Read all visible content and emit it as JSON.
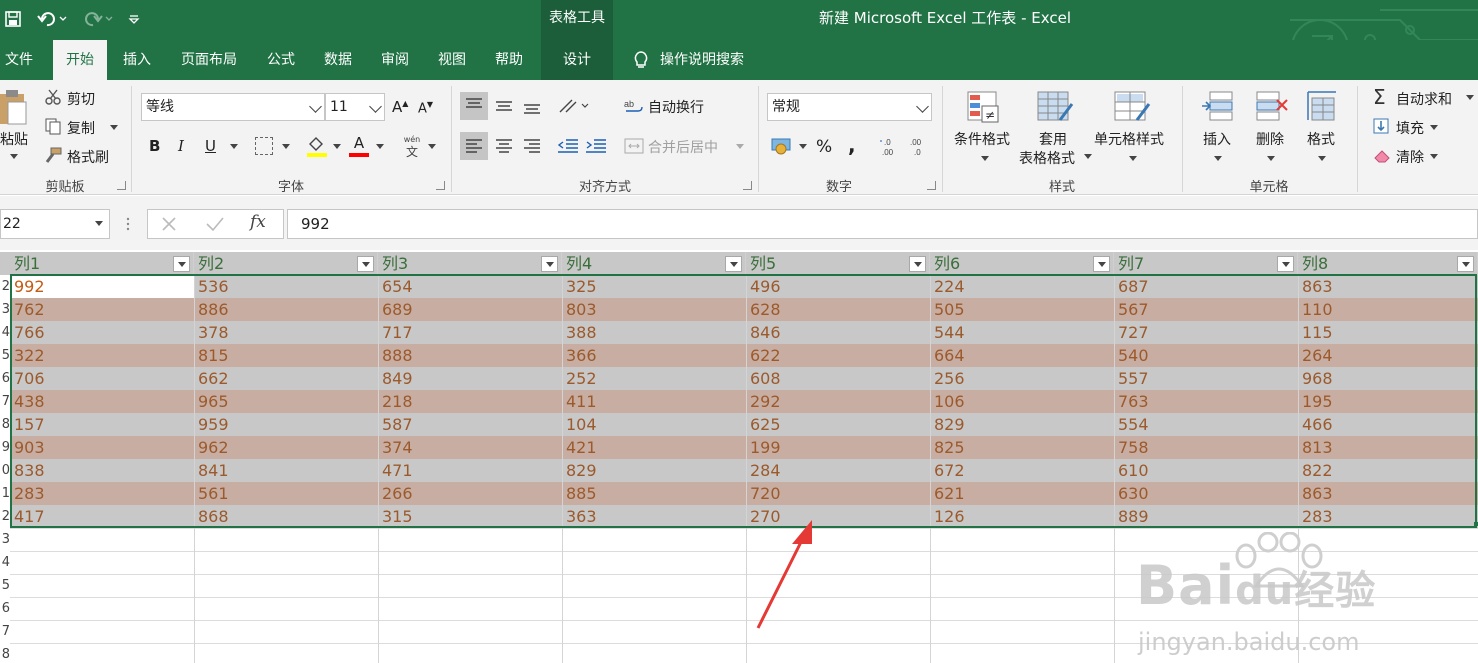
{
  "title_bar": {
    "contextual_label": "表格工具",
    "title": "新建 Microsoft Excel 工作表  -  Excel"
  },
  "tabs": [
    {
      "label": "文件"
    },
    {
      "label": "开始"
    },
    {
      "label": "插入"
    },
    {
      "label": "页面布局"
    },
    {
      "label": "公式"
    },
    {
      "label": "数据"
    },
    {
      "label": "审阅"
    },
    {
      "label": "视图"
    },
    {
      "label": "帮助"
    },
    {
      "label": "设计"
    }
  ],
  "tell_me": "操作说明搜索",
  "ribbon": {
    "clipboard": {
      "paste": "粘贴",
      "cut": "剪切",
      "copy": "复制",
      "format_painter": "格式刷",
      "label": "剪贴板"
    },
    "font": {
      "name": "等线",
      "size": "11",
      "bold": "B",
      "italic": "I",
      "underline": "U",
      "font_color_glyph": "A",
      "phonetic": "wén",
      "phonetic_glyph": "文",
      "grow": "A",
      "shrink": "A",
      "label": "字体"
    },
    "alignment": {
      "wrap": "自动换行",
      "merge": "合并后居中",
      "label": "对齐方式"
    },
    "number": {
      "format": "常规",
      "percent": "%",
      "comma": ",",
      "label": "数字"
    },
    "styles": {
      "conditional": "条件格式",
      "table_line1": "套用",
      "table_line2": "表格格式",
      "cell_styles": "单元格样式",
      "label": "样式"
    },
    "cells": {
      "insert": "插入",
      "delete": "删除",
      "format": "格式",
      "label": "单元格"
    },
    "editing": {
      "autosum": "自动求和",
      "fill": "填充",
      "clear": "清除"
    }
  },
  "formula_bar": {
    "name_box": "22",
    "fx": "fx",
    "value": "992"
  },
  "table": {
    "headers": [
      "列1",
      "列2",
      "列3",
      "列4",
      "列5",
      "列6",
      "列7",
      "列8"
    ],
    "row_numbers": [
      "2",
      "3",
      "4",
      "5",
      "6",
      "7",
      "8",
      "9",
      "0",
      "1",
      "2",
      "3",
      "4",
      "5",
      "6",
      "7",
      "8"
    ],
    "rows": [
      [
        "992",
        "536",
        "654",
        "325",
        "496",
        "224",
        "687",
        "863"
      ],
      [
        "762",
        "886",
        "689",
        "803",
        "628",
        "505",
        "567",
        "110"
      ],
      [
        "766",
        "378",
        "717",
        "388",
        "846",
        "544",
        "727",
        "115"
      ],
      [
        "322",
        "815",
        "888",
        "366",
        "622",
        "664",
        "540",
        "264"
      ],
      [
        "706",
        "662",
        "849",
        "252",
        "608",
        "256",
        "557",
        "968"
      ],
      [
        "438",
        "965",
        "218",
        "411",
        "292",
        "106",
        "763",
        "195"
      ],
      [
        "157",
        "959",
        "587",
        "104",
        "625",
        "829",
        "554",
        "466"
      ],
      [
        "903",
        "962",
        "374",
        "421",
        "199",
        "825",
        "758",
        "813"
      ],
      [
        "838",
        "841",
        "471",
        "829",
        "284",
        "672",
        "610",
        "822"
      ],
      [
        "283",
        "561",
        "266",
        "885",
        "720",
        "621",
        "630",
        "863"
      ],
      [
        "417",
        "868",
        "315",
        "363",
        "270",
        "126",
        "889",
        "283"
      ]
    ],
    "band_colors": {
      "gray": "#c8c8c8",
      "brown": "#c8aea2"
    }
  },
  "watermark": {
    "brand": "Bai",
    "brand2": "du",
    "cn": "经验",
    "url": "jingyan.baidu.com"
  },
  "colors": {
    "excel_green": "#217346",
    "annotation_red": "#e53935"
  }
}
